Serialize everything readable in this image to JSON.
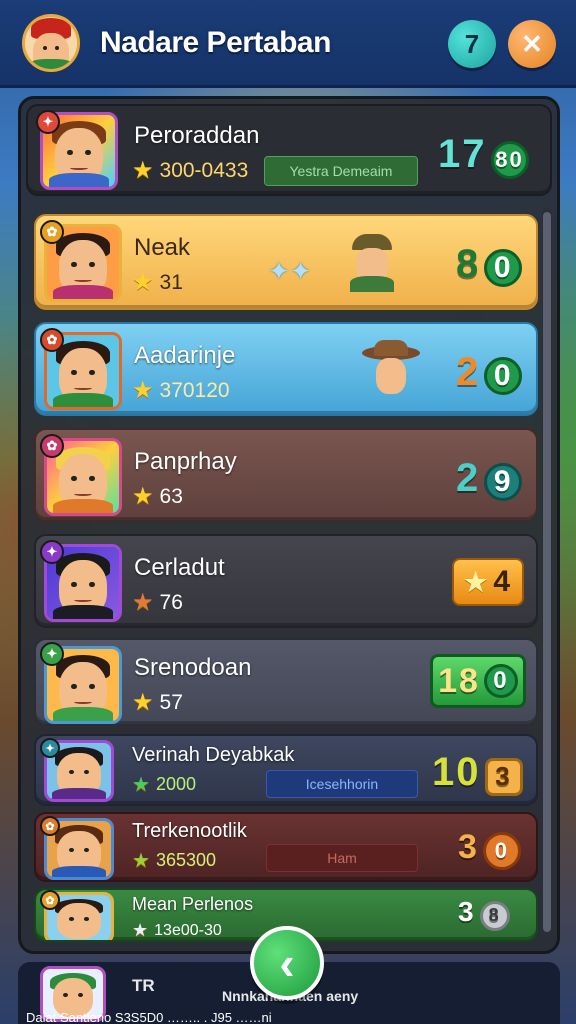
{
  "header": {
    "title": "Nadare Pertaban",
    "info_label": "7",
    "close_label": "✕"
  },
  "player": {
    "name": "Peroraddan",
    "score": "300-0433",
    "tag": "Yestra Demeaim",
    "rank_number": "17",
    "rank_pill": "80"
  },
  "rows": [
    {
      "name": "Neak",
      "score": "31",
      "number": "8",
      "pill": "0",
      "color": "#f4bd58"
    },
    {
      "name": "Aadarinje",
      "score": "370120",
      "number": "2",
      "pill": "0",
      "color": "#58b5e0"
    },
    {
      "name": "Panprhay",
      "score": "63",
      "number": "2",
      "pill": "9",
      "color": "#6c4c46"
    },
    {
      "name": "Cerladut",
      "score": "76",
      "number": "4",
      "pill": "",
      "color": "#3f3f46"
    },
    {
      "name": "Srenodoan",
      "score": "57",
      "number": "18",
      "pill": "0",
      "color": "#494d5a"
    },
    {
      "name": "Verinah Deyabkak",
      "score": "2000",
      "tag": "Icesehhorin",
      "number": "10",
      "pill": "3",
      "color": "#3a4258"
    },
    {
      "name": "Trerkenootlik",
      "score": "365300",
      "tag": "Ham",
      "number": "3",
      "pill": "0",
      "color": "#5a3030"
    },
    {
      "name": "Mean Perlenos",
      "score": "13e00-30",
      "number": "3",
      "pill": "8",
      "color": "#2f6a36"
    }
  ],
  "bottom": {
    "label_a": "TR",
    "label_b": "Nnnkanannaen aeny",
    "footer_text": "Dalat Santieno S3S5D0 …….. . J95 ……ni"
  },
  "back_button": "‹"
}
